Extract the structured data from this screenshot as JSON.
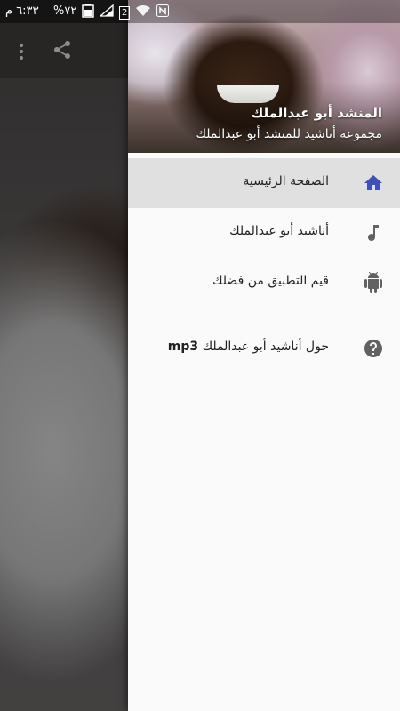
{
  "status_bar": {
    "time": "٦:٣٣ م",
    "battery": "%٧٢",
    "sim": "2"
  },
  "toolbar": {
    "more_icon": "more-vert-icon",
    "share_icon": "share-icon"
  },
  "drawer": {
    "header": {
      "title": "المنشد أبو عبدالملك",
      "subtitle": "مجموعة أناشيد للمنشد أبو عبدالملك"
    },
    "items": [
      {
        "label": "الصفحة الرئيسية",
        "icon": "home-icon",
        "selected": true,
        "accent": "#3f51b5"
      },
      {
        "label": "أناشيد أبو عبدالملك",
        "icon": "music-note-icon",
        "selected": false
      },
      {
        "label": "قيم التطبيق من فضلك",
        "icon": "android-icon",
        "selected": false
      }
    ],
    "about": {
      "label": "حول أناشيد أبو عبدالملك",
      "label_bold": "mp3",
      "icon": "help-icon"
    }
  }
}
